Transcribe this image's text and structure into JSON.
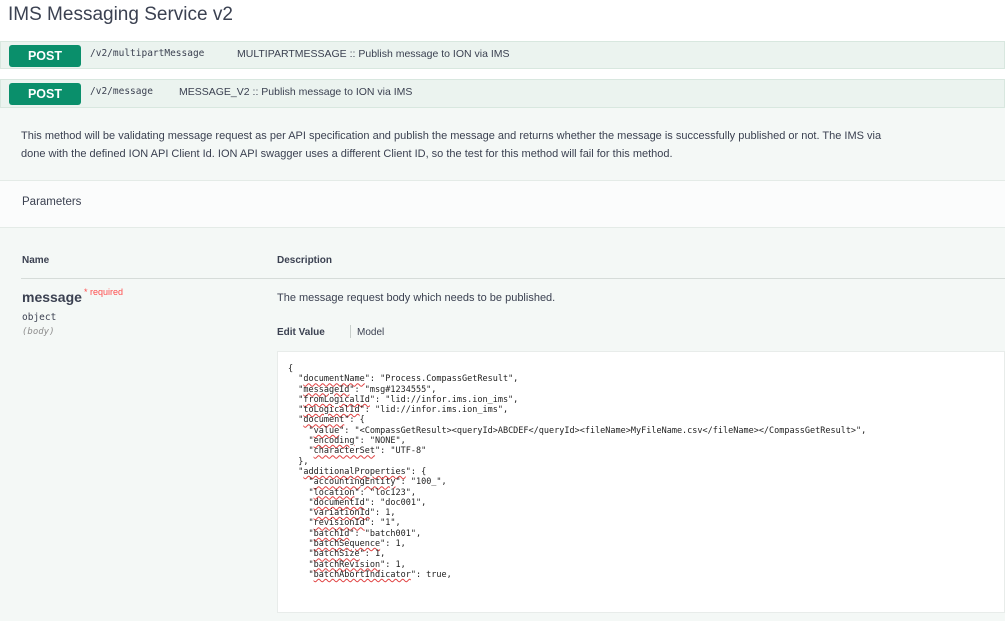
{
  "page": {
    "title": "IMS Messaging Service v2"
  },
  "operations": [
    {
      "method": "POST",
      "path": "/v2/multipartMessage",
      "summary": "MULTIPARTMESSAGE :: Publish message to ION via IMS"
    },
    {
      "method": "POST",
      "path": "/v2/message",
      "summary": "MESSAGE_V2 :: Publish message to ION via IMS"
    }
  ],
  "description": {
    "line1": "This method will be validating message request as per API specification and publish the message and returns whether the message is successfully published or not. The IMS via",
    "line2": "done with the defined ION API Client Id. ION API swagger uses a different Client ID, so the test for this method will fail for this method."
  },
  "parameters": {
    "heading": "Parameters",
    "col_name": "Name",
    "col_description": "Description",
    "param": {
      "name": "message",
      "required_mark": "* required",
      "type": "object",
      "location": "(body)",
      "description": "The message request body which needs to be published."
    },
    "tabs": {
      "edit": "Edit Value",
      "model": "Model"
    }
  },
  "editor": {
    "lines": [
      "{",
      "  \"documentName\": \"Process.CompassGetResult\",",
      "  \"messageId\": \"msg#1234555\",",
      "  \"fromLogicalId\": \"lid://infor.ims.ion_ims\",",
      "  \"toLogicalId\": \"lid://infor.ims.ion_ims\",",
      "  \"document\": {",
      "    \"value\": \"<CompassGetResult><queryId>ABCDEF</queryId><fileName>MyFileName.csv</fileName></CompassGetResult>\",",
      "    \"encoding\": \"NONE\",",
      "    \"characterSet\": \"UTF-8\"",
      "  },",
      "  \"additionalProperties\": {",
      "    \"accountingEntity\": \"100_\",",
      "    \"location\": \"loc123\",",
      "    \"documentId\": \"doc001\",",
      "    \"variationId\": 1,",
      "    \"revisionId\": \"1\",",
      "    \"batchId\": \"batch001\",",
      "    \"batchSequence\": 1,",
      "    \"batchSize\": 1,",
      "    \"batchRevision\": 1,",
      "    \"batchAbortIndicator\": true,"
    ]
  },
  "colors": {
    "post": "#0a8f6b",
    "op_bg": "#ebf3ef",
    "required": "#ff4c4c"
  }
}
